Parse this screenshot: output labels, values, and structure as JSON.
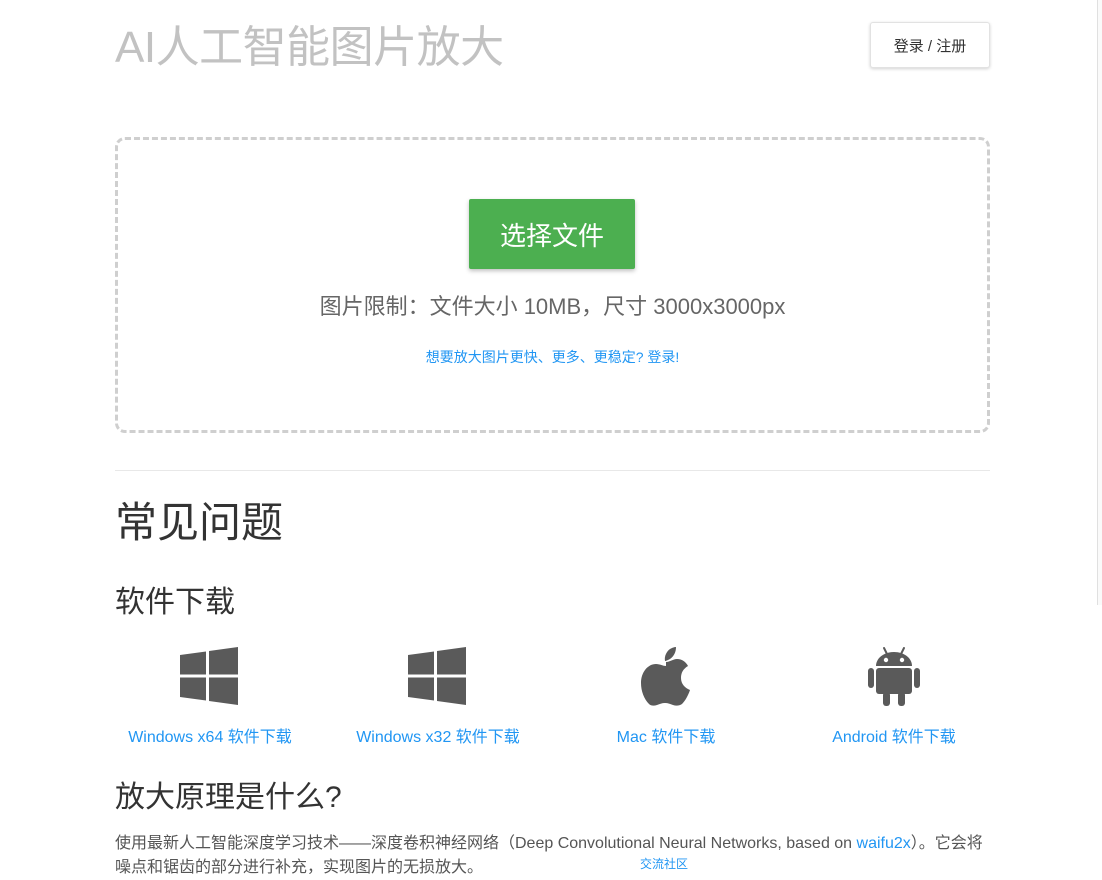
{
  "header": {
    "site_title": "AI人工智能图片放大",
    "login_label": "登录 / 注册"
  },
  "upload": {
    "choose_label": "选择文件",
    "limit_text": "图片限制：文件大小 10MB，尺寸 3000x3000px",
    "login_hint": "想要放大图片更快、更多、更稳定? 登录!"
  },
  "faq": {
    "title": "常见问题",
    "downloads_title": "软件下载",
    "downloads": [
      {
        "label": "Windows x64 软件下载",
        "icon": "windows-icon"
      },
      {
        "label": "Windows x32 软件下载",
        "icon": "windows-icon"
      },
      {
        "label": "Mac 软件下载",
        "icon": "apple-icon"
      },
      {
        "label": "Android 软件下载",
        "icon": "android-icon"
      }
    ],
    "principle_title": "放大原理是什么?",
    "principle_text_before": "使用最新人工智能深度学习技术——深度卷积神经网络（Deep Convolutional Neural Networks, based on ",
    "principle_link": "waifu2x",
    "principle_text_after": "）。它会将噪点和锯齿的部分进行补充，实现图片的无损放大。",
    "floating_link": "交流社区"
  },
  "colors": {
    "accent_green": "#4caf50",
    "link_blue": "#2196f3",
    "icon_gray": "#5a5a5a"
  }
}
